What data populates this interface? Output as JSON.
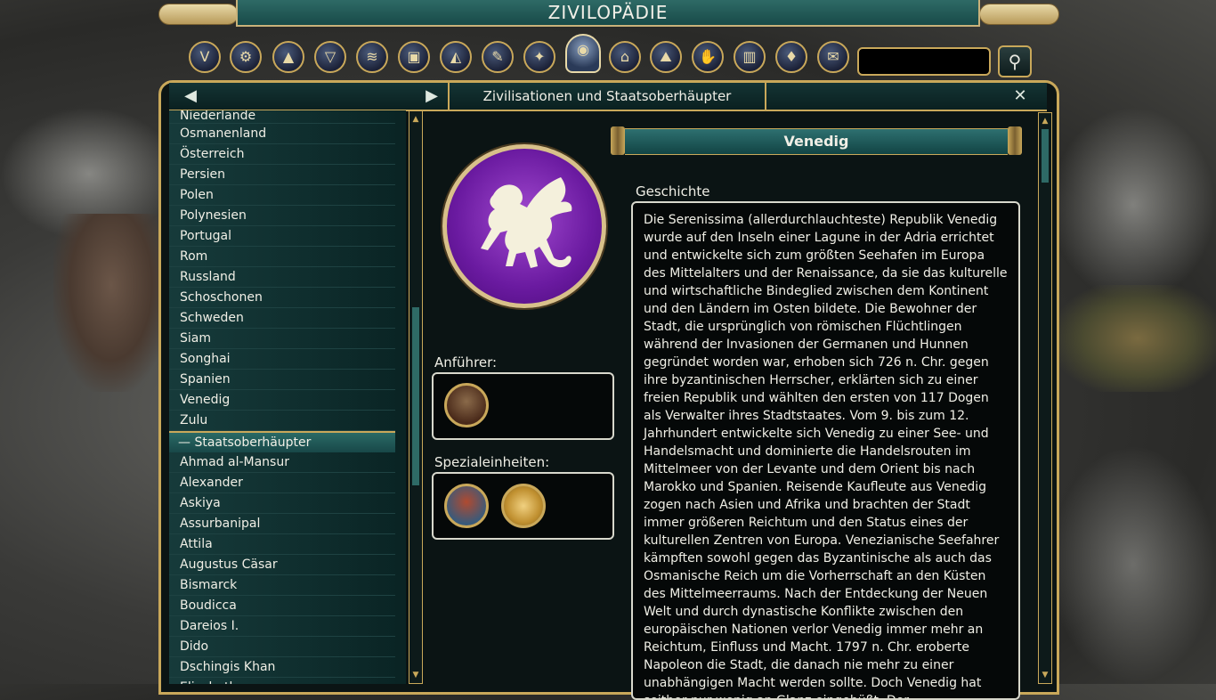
{
  "title": "ZIVILOPÄDIE",
  "categories": [
    {
      "name": "home-icon",
      "glyph": "V"
    },
    {
      "name": "tech-icon",
      "glyph": "⚙"
    },
    {
      "name": "units-icon",
      "glyph": "▲"
    },
    {
      "name": "promotions-icon",
      "glyph": "▽"
    },
    {
      "name": "ranks-icon",
      "glyph": "≋"
    },
    {
      "name": "buildings-icon",
      "glyph": "▣"
    },
    {
      "name": "wonders-icon",
      "glyph": "◭"
    },
    {
      "name": "policies-icon",
      "glyph": "✎"
    },
    {
      "name": "great-people-icon",
      "glyph": "✦"
    },
    {
      "name": "civilizations-icon",
      "glyph": "◉"
    },
    {
      "name": "city-states-icon",
      "glyph": "⌂"
    },
    {
      "name": "terrain-icon",
      "glyph": "⛰"
    },
    {
      "name": "resources-icon",
      "glyph": "✋"
    },
    {
      "name": "improvements-icon",
      "glyph": "▥"
    },
    {
      "name": "religion-icon",
      "glyph": "♦"
    },
    {
      "name": "world-congress-icon",
      "glyph": "✉"
    }
  ],
  "search": {
    "placeholder": "",
    "value": ""
  },
  "nav": {
    "back": "◀",
    "forward": "▶",
    "title": "Zivilisationen und Staatsoberhäupter",
    "close": "✕"
  },
  "list": {
    "civilizations": [
      "Niederlande",
      "Osmanenland",
      "Österreich",
      "Persien",
      "Polen",
      "Polynesien",
      "Portugal",
      "Rom",
      "Russland",
      "Schoschonen",
      "Schweden",
      "Siam",
      "Songhai",
      "Spanien",
      "Venedig",
      "Zulu"
    ],
    "leaders_header": "—  Staatsoberhäupter",
    "leaders": [
      "Ahmad al-Mansur",
      "Alexander",
      "Askiya",
      "Assurbanipal",
      "Attila",
      "Augustus Cäsar",
      "Bismarck",
      "Boudicca",
      "Dareios I.",
      "Dido",
      "Dschingis Khan",
      "Elisabeth"
    ]
  },
  "detail": {
    "civ_name": "Venedig",
    "leader_label": "Anführer:",
    "units_label": "Spezialeinheiten:",
    "history_label": "Geschichte",
    "history_text": "Die Serenissima (allerdurchlauchteste) Republik Venedig wurde auf den Inseln einer Lagune in der Adria errichtet und entwickelte sich zum größten Seehafen im Europa des Mittelalters und der Renaissance, da sie das kulturelle und wirtschaftliche Bindeglied zwischen dem Kontinent und den Ländern im Osten bildete. Die Bewohner der Stadt, die ursprünglich von römischen Flüchtlingen während der Invasionen der Germanen und Hunnen gegründet worden war, erhoben sich 726 n. Chr. gegen ihre byzantinischen Herrscher, erklärten sich zu einer freien Republik und wählten den ersten von 117 Dogen als Verwalter ihres Stadtstaates. Vom 9. bis zum 12. Jahrhundert entwickelte sich Venedig zu einer See- und Handelsmacht und dominierte die Handelsrouten im Mittelmeer von der Levante und dem Orient bis nach Marokko und Spanien. Reisende Kaufleute aus Venedig zogen nach Asien und Afrika und brachten der Stadt immer größeren Reichtum und den Status eines der kulturellen Zentren von Europa. Venezianische Seefahrer kämpften sowohl gegen das Byzantinische als auch das Osmanische Reich um die Vorherrschaft an den Küsten des Mittelmeerraums. Nach der Entdeckung der Neuen Welt und durch dynastische Konflikte zwischen den europäischen Nationen verlor Venedig immer mehr an Reichtum, Einfluss und Macht. 1797 n. Chr. eroberte Napoleon die Stadt, die danach nie mehr zu einer unabhängigen Macht werden sollte. Doch Venedig hat seither nur wenig an Glanz eingebüßt. Der"
  },
  "colors": {
    "gold": "#c9a85a",
    "teal": "#2e6a66",
    "emblem_purple": "#6a1aa0"
  }
}
